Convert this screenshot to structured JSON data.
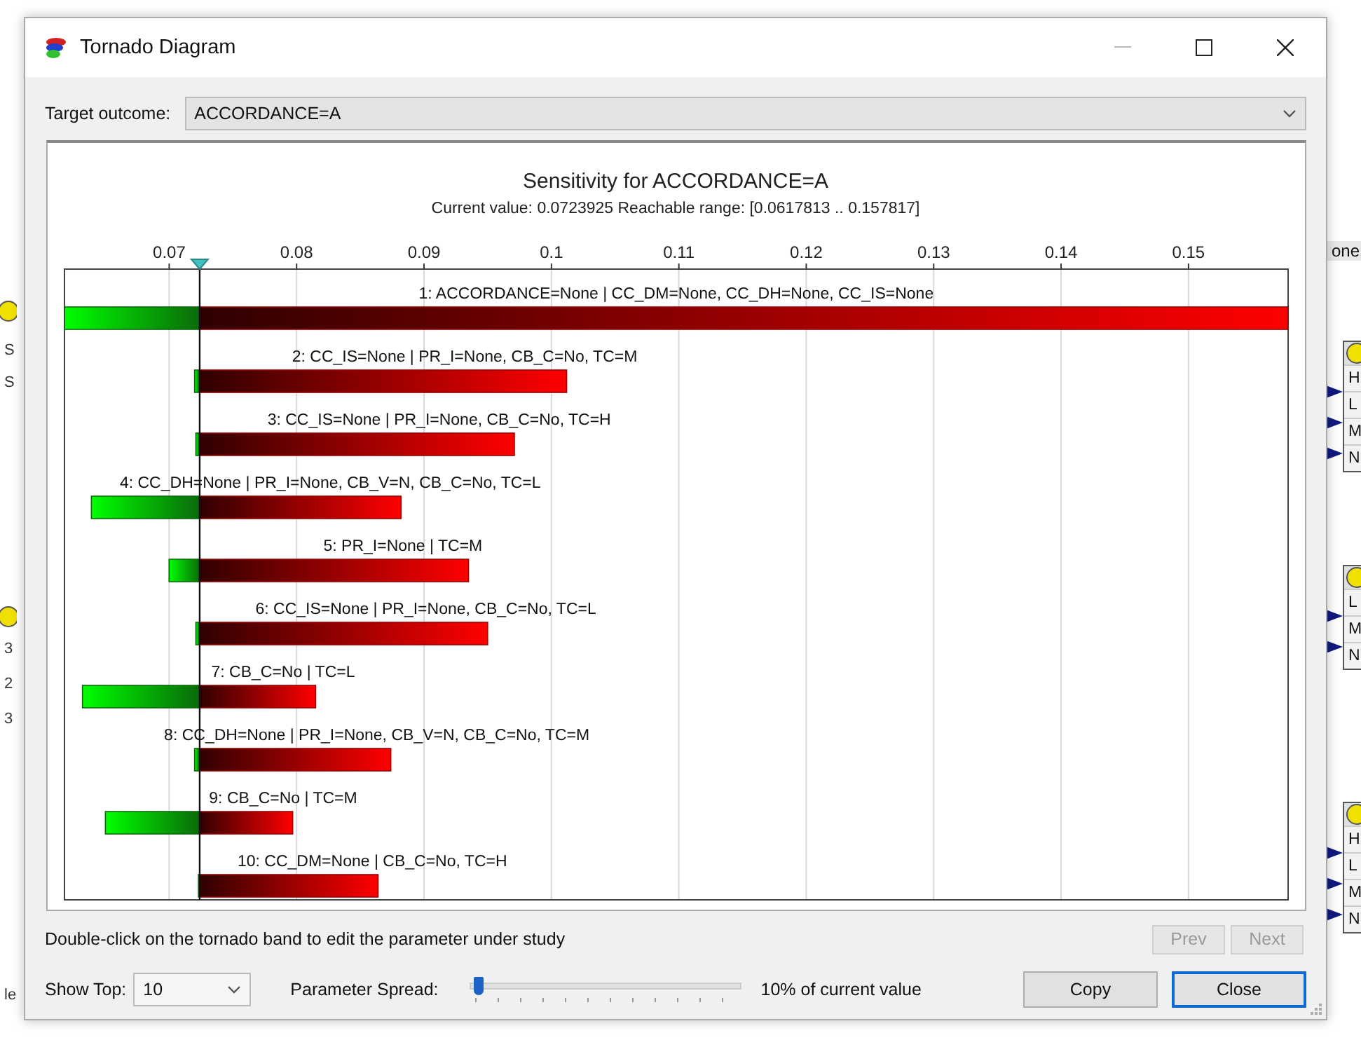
{
  "window": {
    "title": "Tornado Diagram"
  },
  "target_outcome": {
    "label": "Target outcome:",
    "value": "ACCORDANCE=A"
  },
  "chart": {
    "title": "Sensitivity for ACCORDANCE=A",
    "subtitle": "Current value: 0.0723925  Reachable range: [0.0617813 .. 0.157817]",
    "chart_data": {
      "type": "bar",
      "orientation": "horizontal",
      "grid": true,
      "categories": [
        "1: ACCORDANCE=None | CC_DM=None, CC_DH=None, CC_IS=None",
        "2: CC_IS=None | PR_I=None, CB_C=No, TC=M",
        "3: CC_IS=None | PR_I=None, CB_C=No, TC=H",
        "4: CC_DH=None | PR_I=None, CB_V=N, CB_C=No, TC=L",
        "5: PR_I=None | TC=M",
        "6: CC_IS=None | PR_I=None, CB_C=No, TC=L",
        "7: CB_C=No | TC=L",
        "8: CC_DH=None | PR_I=None, CB_V=N, CB_C=No, TC=M",
        "9: CB_C=No | TC=M",
        "10: CC_DM=None | CB_C=No, TC=H"
      ],
      "series": [
        {
          "color": "#0a6a0a",
          "base": [
            0.0723925,
            0.0723925,
            0.0723925,
            0.0723925,
            0.0723925,
            0.0723925,
            0.0723925,
            0.0723925,
            0.0723925,
            0.0723925
          ],
          "values": [
            -0.0106,
            -0.0004,
            -0.0003,
            -0.0085,
            -0.0024,
            -0.0003,
            -0.0092,
            -0.0004,
            -0.0074,
            -0.0001
          ]
        },
        {
          "color": "#990000",
          "base": [
            0.0723925,
            0.0723925,
            0.0723925,
            0.0723925,
            0.0723925,
            0.0723925,
            0.0723925,
            0.0723925,
            0.0723925,
            0.0723925
          ],
          "values": [
            0.0854,
            0.0288,
            0.0247,
            0.0158,
            0.0211,
            0.0226,
            0.0091,
            0.015,
            0.0073,
            0.014
          ]
        }
      ],
      "xlim": [
        0.0617813,
        0.157817
      ],
      "xticks": [
        {
          "value": 0.07,
          "label": "0.07"
        },
        {
          "value": 0.08,
          "label": "0.08"
        },
        {
          "value": 0.09,
          "label": "0.09"
        },
        {
          "value": 0.1,
          "label": "0.1"
        },
        {
          "value": 0.11,
          "label": "0.11"
        },
        {
          "value": 0.12,
          "label": "0.12"
        },
        {
          "value": 0.13,
          "label": "0.13"
        },
        {
          "value": 0.14,
          "label": "0.14"
        },
        {
          "value": 0.15,
          "label": "0.15"
        }
      ]
    }
  },
  "hint": "Double-click on the tornado band to edit the parameter under study",
  "nav_buttons": [
    {
      "label": "Prev",
      "disabled": true
    },
    {
      "label": "Next",
      "disabled": true
    }
  ],
  "show_top": {
    "label": "Show Top:",
    "value": "10"
  },
  "parameter_spread": {
    "label": "Parameter Spread:",
    "level": 0.02,
    "reading": "10% of current value"
  },
  "buttons": [
    {
      "label": "Copy",
      "focused": false
    },
    {
      "label": "Close",
      "focused": true
    }
  ],
  "background": {
    "left_texts": [
      "S",
      "S",
      "3",
      "2",
      "3",
      "le"
    ],
    "right_label": "one",
    "right_nodes": [
      {
        "states": [
          "H",
          "L",
          "M",
          "N"
        ]
      },
      {
        "states": [
          "L",
          "M",
          "N"
        ]
      },
      {
        "states": [
          "H",
          "L",
          "M",
          "N"
        ]
      }
    ]
  }
}
